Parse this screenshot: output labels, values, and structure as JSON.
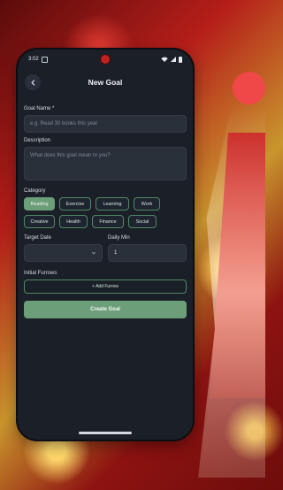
{
  "status": {
    "time": "3:02"
  },
  "appbar": {
    "title": "New Goal"
  },
  "form": {
    "goal_name": {
      "label": "Goal Name *",
      "placeholder": "e.g. Read 30 books this year"
    },
    "description": {
      "label": "Description",
      "placeholder": "What does this goal mean to you?"
    },
    "category": {
      "label": "Category",
      "chips": [
        "Reading",
        "Exercise",
        "Learning",
        "Work",
        "Creative",
        "Health",
        "Finance",
        "Social"
      ],
      "selected": "Reading"
    },
    "target_date": {
      "label": "Target Date"
    },
    "daily_min": {
      "label": "Daily Min",
      "value": "1"
    },
    "furrows": {
      "label": "Initial Furrows",
      "add_label": "+ Add Furrow"
    },
    "create_label": "Create Goal"
  },
  "colors": {
    "accent": "#6c9e79",
    "surface": "#1b1f28",
    "input": "#2a3039"
  },
  "icons": [
    "back-arrow-icon",
    "chevron-down-icon",
    "wifi-icon",
    "signal-icon",
    "battery-icon"
  ]
}
